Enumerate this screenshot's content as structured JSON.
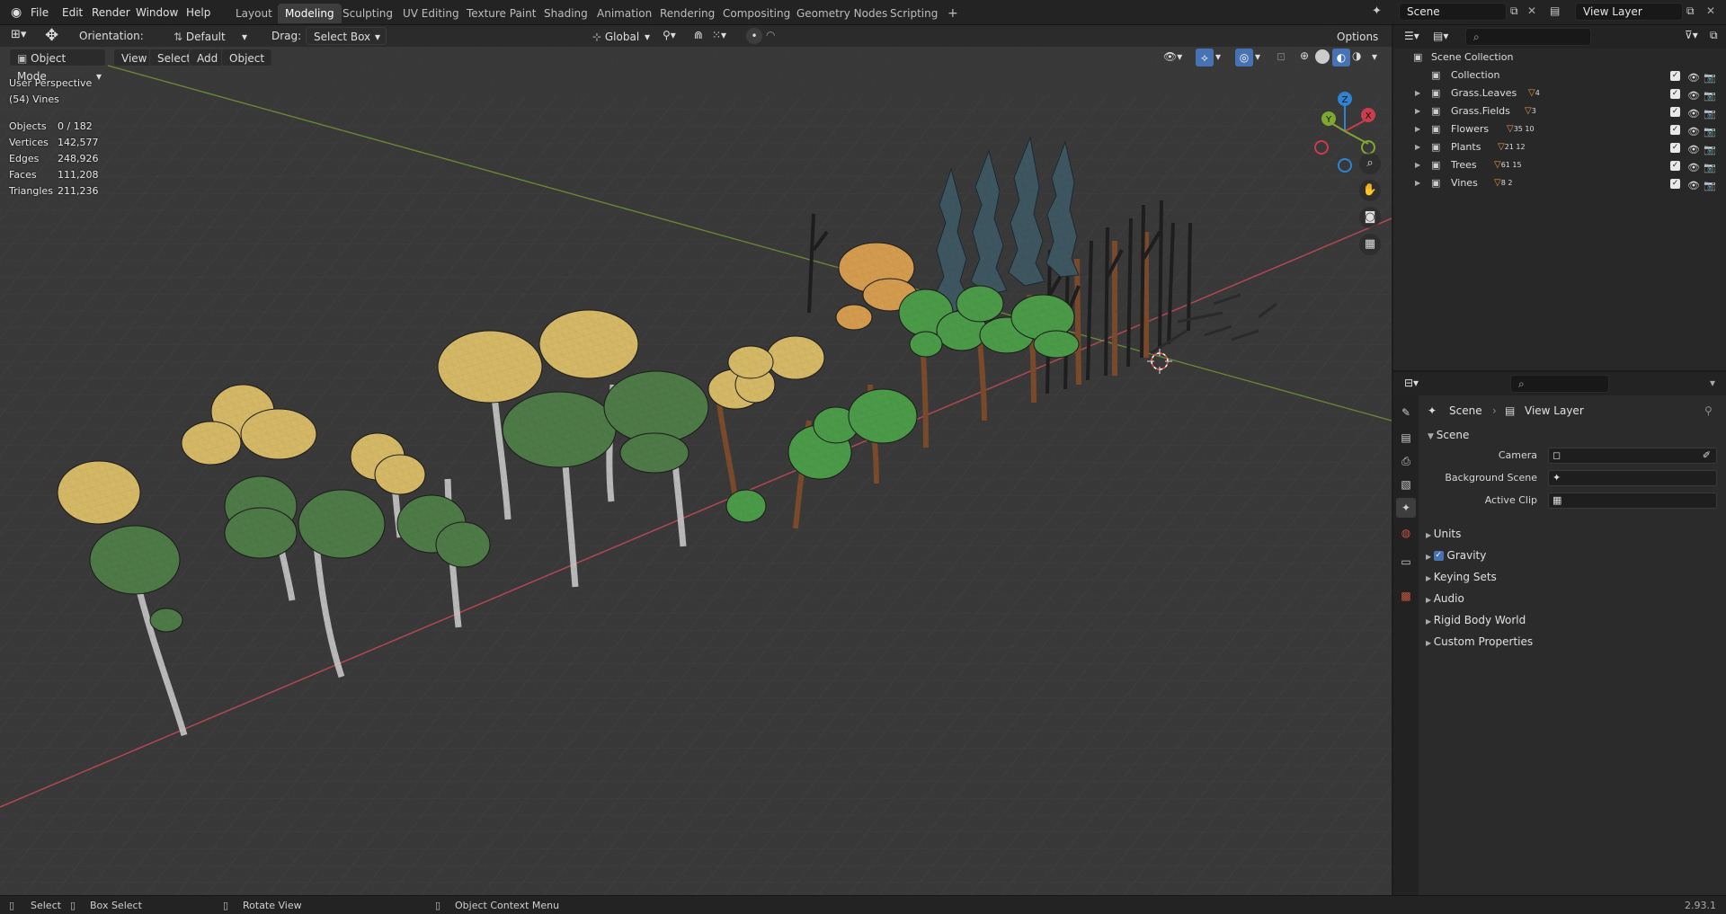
{
  "menus": [
    "File",
    "Edit",
    "Render",
    "Window",
    "Help"
  ],
  "workspaces": [
    "Layout",
    "Modeling",
    "Sculpting",
    "UV Editing",
    "Texture Paint",
    "Shading",
    "Animation",
    "Rendering",
    "Compositing",
    "Geometry Nodes",
    "Scripting"
  ],
  "active_workspace": "Modeling",
  "scene_name": "Scene",
  "view_layer_name": "View Layer",
  "viewport_header": {
    "orientation_label": "Orientation:",
    "orientation_value": "Default",
    "drag_label": "Drag:",
    "drag_value": "Select Box",
    "transform_space": "Global",
    "options_label": "Options"
  },
  "viewport_subheader": {
    "mode": "Object Mode",
    "menus": [
      "View",
      "Select",
      "Add",
      "Object"
    ]
  },
  "overlay": {
    "perspective": "User Perspective",
    "active_object": "(54) Vines"
  },
  "stats": [
    {
      "label": "Objects",
      "value": "0 / 182"
    },
    {
      "label": "Vertices",
      "value": "142,577"
    },
    {
      "label": "Edges",
      "value": "248,926"
    },
    {
      "label": "Faces",
      "value": "111,208"
    },
    {
      "label": "Triangles",
      "value": "211,236"
    }
  ],
  "gizmo": {
    "x": "X",
    "y": "Y",
    "z": "Z"
  },
  "outliner": {
    "root": "Scene Collection",
    "items": [
      {
        "name": "Collection",
        "badges": ""
      },
      {
        "name": "Grass.Leaves",
        "badges": "4"
      },
      {
        "name": "Grass.Fields",
        "badges": "3"
      },
      {
        "name": "Flowers",
        "badges": "35 10"
      },
      {
        "name": "Plants",
        "badges": "21 12"
      },
      {
        "name": "Trees",
        "badges": "61 15"
      },
      {
        "name": "Vines",
        "badges": "8 2"
      }
    ]
  },
  "properties": {
    "breadcrumb_scene": "Scene",
    "breadcrumb_view_layer": "View Layer",
    "panel_title": "Scene",
    "fields": [
      {
        "label": "Camera"
      },
      {
        "label": "Background Scene"
      },
      {
        "label": "Active Clip"
      }
    ],
    "collapsed_panels": [
      "Units",
      "Gravity",
      "Keying Sets",
      "Audio",
      "Rigid Body World",
      "Custom Properties"
    ],
    "gravity_checked": true
  },
  "statusbar": {
    "select": "Select",
    "box_select": "Box Select",
    "rotate_view": "Rotate View",
    "context_menu": "Object Context Menu",
    "version": "2.93.1"
  },
  "colors": {
    "viewport_bg": "#393939",
    "accent_active": "#4772b3",
    "x_axis": "#c93d4c",
    "y_axis": "#7fa832",
    "z_axis": "#2f83d1",
    "foliage_yellow": "#d4b865",
    "foliage_green": "#4d7a46",
    "foliage_bright": "#4a9a48",
    "foliage_orange": "#d39b4e"
  }
}
